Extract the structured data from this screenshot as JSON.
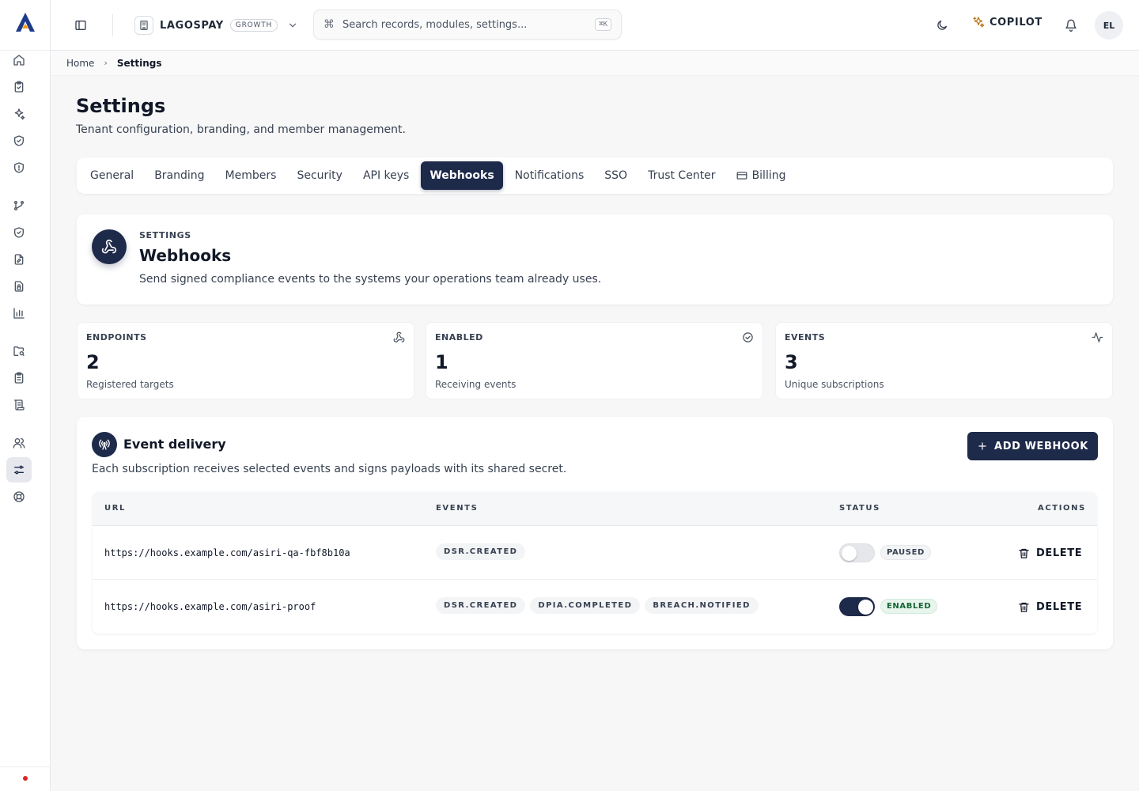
{
  "topbar": {
    "tenant_name": "LAGOSPAY",
    "plan_badge": "GROWTH",
    "search_placeholder": "Search records, modules, settings...",
    "search_shortcut": "⌘K",
    "copilot_label": "COPILOT",
    "avatar_initials": "EL"
  },
  "breadcrumb": {
    "home": "Home",
    "separator": "›",
    "current": "Settings"
  },
  "page": {
    "title": "Settings",
    "subtitle": "Tenant configuration, branding, and member management."
  },
  "tabs": [
    {
      "label": "General",
      "active": false
    },
    {
      "label": "Branding",
      "active": false
    },
    {
      "label": "Members",
      "active": false
    },
    {
      "label": "Security",
      "active": false
    },
    {
      "label": "API keys",
      "active": false
    },
    {
      "label": "Webhooks",
      "active": true
    },
    {
      "label": "Notifications",
      "active": false
    },
    {
      "label": "SSO",
      "active": false
    },
    {
      "label": "Trust Center",
      "active": false
    },
    {
      "label": "Billing",
      "active": false,
      "icon": "credit-card-icon"
    }
  ],
  "hero": {
    "eyebrow": "SETTINGS",
    "title": "Webhooks",
    "description": "Send signed compliance events to the systems your operations team already uses.",
    "icon": "webhook-icon"
  },
  "stats": [
    {
      "label": "ENDPOINTS",
      "value": "2",
      "sub": "Registered targets",
      "icon": "webhook-icon"
    },
    {
      "label": "ENABLED",
      "value": "1",
      "sub": "Receiving events",
      "icon": "check-circle-icon"
    },
    {
      "label": "EVENTS",
      "value": "3",
      "sub": "Unique subscriptions",
      "icon": "activity-icon"
    }
  ],
  "delivery": {
    "title": "Event delivery",
    "description": "Each subscription receives selected events and signs payloads with its shared secret.",
    "add_label": "ADD WEBHOOK",
    "columns": {
      "url": "URL",
      "events": "EVENTS",
      "status": "STATUS",
      "actions": "ACTIONS"
    },
    "rows": [
      {
        "url": "https://hooks.example.com/asiri-qa-fbf8b10a",
        "events": [
          "DSR.CREATED"
        ],
        "enabled": false,
        "status": "PAUSED",
        "action": "DELETE"
      },
      {
        "url": "https://hooks.example.com/asiri-proof",
        "events": [
          "DSR.CREATED",
          "DPIA.COMPLETED",
          "BREACH.NOTIFIED"
        ],
        "enabled": true,
        "status": "ENABLED",
        "action": "DELETE"
      }
    ]
  },
  "colors": {
    "primary": "#1e2a4a",
    "status_dot": "#dc2626",
    "enabled_badge_bg": "#e7f5ec",
    "enabled_badge_text": "#166534",
    "copilot_icon": "#b7791f"
  },
  "sidebar_icons": [
    "home-icon",
    "clipboard-check-icon",
    "sparkles-icon",
    "shield-check-icon",
    "shield-icon",
    "git-branch-icon",
    "shield-check-icon",
    "file-edit-icon",
    "file-lock-icon",
    "bar-chart-icon",
    "folder-search-icon",
    "clipboard-list-icon",
    "scroll-icon",
    "users-icon",
    "settings-sliders-icon",
    "life-buoy-icon"
  ]
}
